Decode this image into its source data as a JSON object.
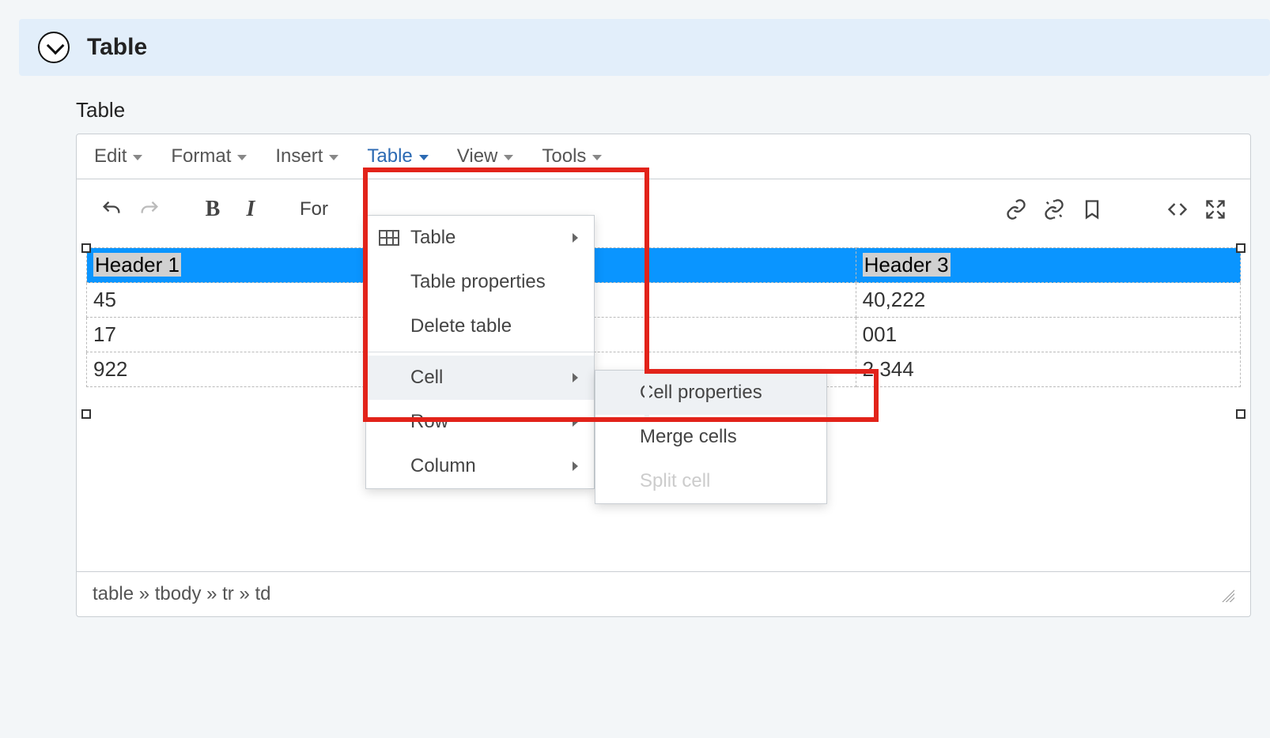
{
  "panel": {
    "title": "Table"
  },
  "field_label": "Table",
  "menubar": {
    "items": [
      {
        "label": "Edit"
      },
      {
        "label": "Format"
      },
      {
        "label": "Insert"
      },
      {
        "label": "Table",
        "active": true
      },
      {
        "label": "View"
      },
      {
        "label": "Tools"
      }
    ]
  },
  "toolbar": {
    "formats_prefix": "For"
  },
  "table_dropdown": {
    "items": [
      {
        "label": "Table",
        "has_submenu": true,
        "icon": "table"
      },
      {
        "label": "Table properties"
      },
      {
        "label": "Delete table"
      }
    ],
    "section2": [
      {
        "label": "Cell",
        "has_submenu": true,
        "hover": true
      },
      {
        "label": "Row",
        "has_submenu": true
      },
      {
        "label": "Column",
        "has_submenu": true
      }
    ]
  },
  "cell_submenu": {
    "items": [
      {
        "label": "Cell properties",
        "hover": true
      },
      {
        "label": "Merge cells"
      },
      {
        "label": "Split cell",
        "disabled": true
      }
    ]
  },
  "table": {
    "headers": [
      "Header 1",
      "",
      "Header 3"
    ],
    "rows": [
      [
        "45",
        "",
        "40,222"
      ],
      [
        "17",
        "",
        "001"
      ],
      [
        "922",
        "",
        "2,344"
      ]
    ]
  },
  "statusbar": {
    "path": "table » tbody » tr » td"
  }
}
